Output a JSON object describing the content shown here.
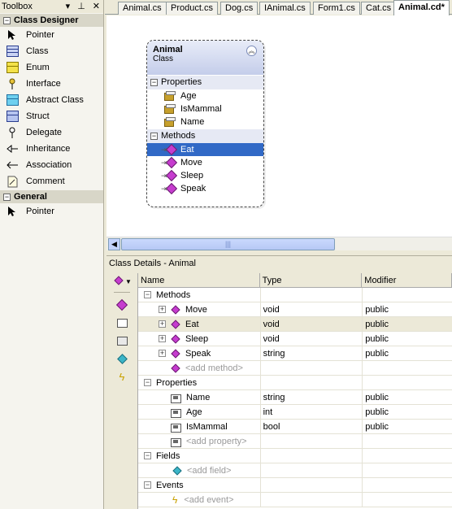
{
  "toolbox": {
    "title": "Toolbox",
    "pin_icon": "pin-icon",
    "close_icon": "close-icon",
    "groups": [
      {
        "label": "Class Designer",
        "items": [
          {
            "label": "Pointer",
            "icon": "pointer-icon"
          },
          {
            "label": "Class",
            "icon": "class-icon"
          },
          {
            "label": "Enum",
            "icon": "enum-icon"
          },
          {
            "label": "Interface",
            "icon": "interface-icon"
          },
          {
            "label": "Abstract Class",
            "icon": "abstract-class-icon"
          },
          {
            "label": "Struct",
            "icon": "struct-icon"
          },
          {
            "label": "Delegate",
            "icon": "delegate-icon"
          },
          {
            "label": "Inheritance",
            "icon": "inheritance-icon"
          },
          {
            "label": "Association",
            "icon": "association-icon"
          },
          {
            "label": "Comment",
            "icon": "comment-icon"
          }
        ]
      },
      {
        "label": "General",
        "items": [
          {
            "label": "Pointer",
            "icon": "pointer-icon"
          }
        ]
      }
    ]
  },
  "tabs": [
    {
      "label": "Animal.cs"
    },
    {
      "label": "Product.cs"
    },
    {
      "label": "Dog.cs"
    },
    {
      "label": "IAnimal.cs"
    },
    {
      "label": "Form1.cs"
    },
    {
      "label": "Cat.cs"
    },
    {
      "label": "Animal.cd*",
      "active": true
    }
  ],
  "diagram": {
    "shape": {
      "name": "Animal",
      "kind": "Class",
      "sections": [
        {
          "label": "Properties",
          "members": [
            "Age",
            "IsMammal",
            "Name"
          ]
        },
        {
          "label": "Methods",
          "members": [
            "Eat",
            "Move",
            "Sleep",
            "Speak"
          ],
          "selected": "Eat"
        }
      ]
    }
  },
  "class_details": {
    "title": "Class Details - Animal",
    "columns": {
      "name": "Name",
      "type": "Type",
      "modifier": "Modifier"
    },
    "groups": [
      {
        "label": "Methods",
        "rows": [
          {
            "name": "Move",
            "type": "void",
            "modifier": "public"
          },
          {
            "name": "Eat",
            "type": "void",
            "modifier": "public",
            "highlighted": true
          },
          {
            "name": "Sleep",
            "type": "void",
            "modifier": "public"
          },
          {
            "name": "Speak",
            "type": "string",
            "modifier": "public"
          }
        ],
        "add_label": "<add method>"
      },
      {
        "label": "Properties",
        "rows": [
          {
            "name": "Name",
            "type": "string",
            "modifier": "public"
          },
          {
            "name": "Age",
            "type": "int",
            "modifier": "public"
          },
          {
            "name": "IsMammal",
            "type": "bool",
            "modifier": "public"
          }
        ],
        "add_label": "<add property>"
      },
      {
        "label": "Fields",
        "rows": [],
        "add_label": "<add field>"
      },
      {
        "label": "Events",
        "rows": [],
        "add_label": "<add event>"
      }
    ]
  }
}
